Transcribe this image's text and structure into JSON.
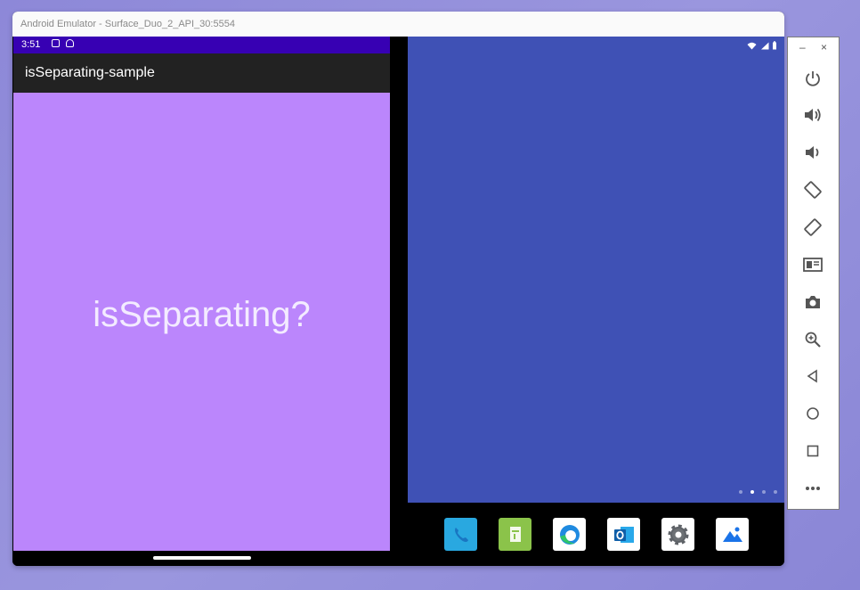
{
  "window": {
    "title": "Android Emulator - Surface_Duo_2_API_30:5554"
  },
  "left_screen": {
    "status_time": "3:51",
    "app_title": "isSeparating-sample",
    "center_text": "isSeparating?",
    "colors": {
      "background": "#bb86fc",
      "statusbar": "#3700b3",
      "appbar": "#222222"
    }
  },
  "right_screen": {
    "status_icons": [
      "wifi-icon",
      "signal-icon",
      "battery-icon"
    ],
    "page_dots": {
      "count": 4,
      "active_index": 1
    },
    "background": "#3f51b5"
  },
  "dock": {
    "apps": [
      {
        "name": "phone-app-icon",
        "bg": "#29a8e0"
      },
      {
        "name": "messages-app-icon",
        "bg": "#8bc34a"
      },
      {
        "name": "edge-app-icon",
        "bg": "#ffffff"
      },
      {
        "name": "outlook-app-icon",
        "bg": "#ffffff"
      },
      {
        "name": "settings-app-icon",
        "bg": "#ffffff"
      },
      {
        "name": "photos-app-icon",
        "bg": "#ffffff"
      }
    ]
  },
  "side_panel": {
    "minimize_label": "–",
    "close_label": "×",
    "buttons": [
      "power-icon",
      "volume-up-icon",
      "volume-down-icon",
      "rotate-left-icon",
      "rotate-right-icon",
      "fold-icon",
      "camera-icon",
      "zoom-icon",
      "back-icon",
      "home-icon",
      "overview-icon",
      "more-icon"
    ]
  }
}
